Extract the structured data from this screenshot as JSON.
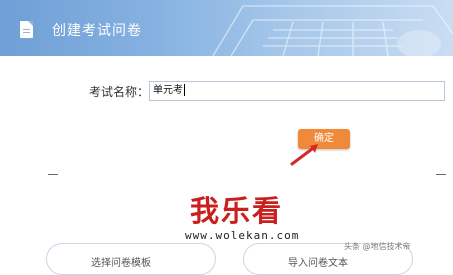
{
  "header": {
    "title": "创建考试问卷",
    "icon": "document-icon",
    "background_color": "#7fa9dc"
  },
  "form": {
    "exam_name_label": "考试名称：",
    "exam_name_value": "单元考"
  },
  "actions": {
    "confirm_label": "确定",
    "confirm_color": "#f08a3a"
  },
  "cards": [
    {
      "label": "选择问卷模板"
    },
    {
      "label": "导入问卷文本"
    }
  ],
  "watermark": {
    "text": "我乐看",
    "url": "www.wolekan.com"
  },
  "credit": "头条 @地信技术帝"
}
